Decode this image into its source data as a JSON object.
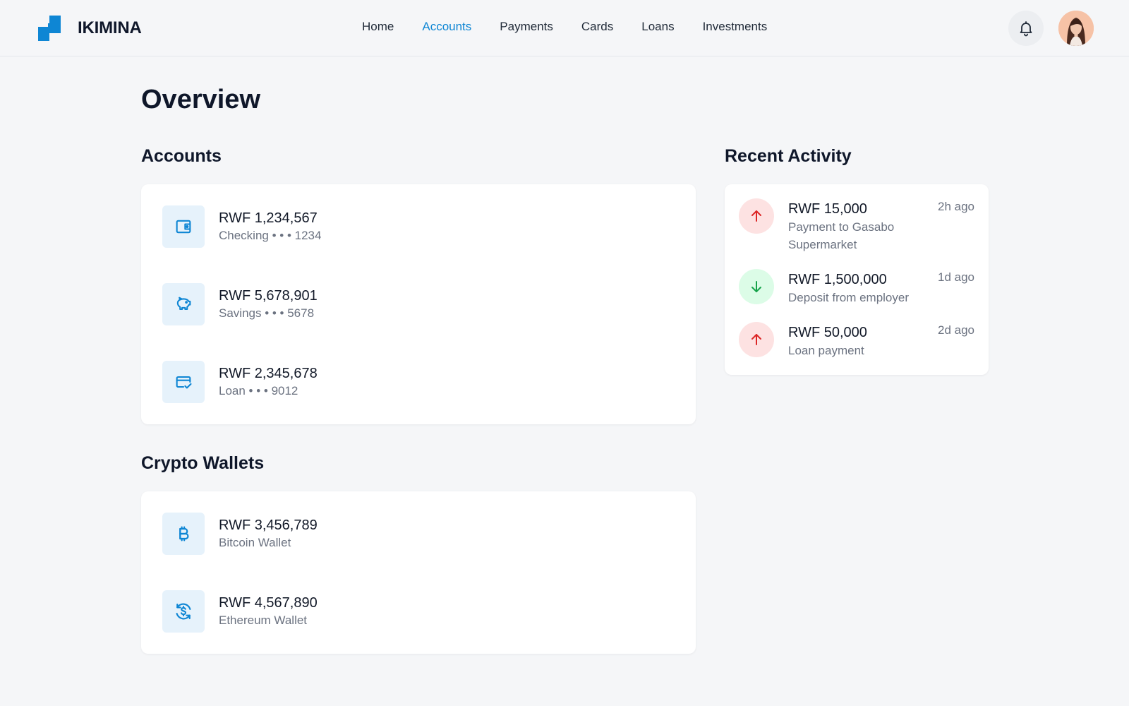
{
  "brand": {
    "name": "IKIMINA"
  },
  "nav": {
    "items": [
      {
        "label": "Home"
      },
      {
        "label": "Accounts"
      },
      {
        "label": "Payments"
      },
      {
        "label": "Cards"
      },
      {
        "label": "Loans"
      },
      {
        "label": "Investments"
      }
    ],
    "active": "Accounts"
  },
  "header": {
    "bell_icon": "bell-icon",
    "avatar": "user-avatar"
  },
  "page": {
    "title": "Overview"
  },
  "accounts": {
    "title": "Accounts",
    "items": [
      {
        "amount": "RWF 1,234,567",
        "label": "Checking • • • 1234",
        "icon": "wallet-icon"
      },
      {
        "amount": "RWF 5,678,901",
        "label": "Savings • • • 5678",
        "icon": "piggy-bank-icon"
      },
      {
        "amount": "RWF 2,345,678",
        "label": "Loan • • • 9012",
        "icon": "credit-card-check-icon"
      }
    ]
  },
  "crypto": {
    "title": "Crypto Wallets",
    "items": [
      {
        "amount": "RWF 3,456,789",
        "label": "Bitcoin Wallet",
        "icon": "bitcoin-icon"
      },
      {
        "amount": "RWF 4,567,890",
        "label": "Ethereum Wallet",
        "icon": "currency-exchange-icon"
      }
    ]
  },
  "activity": {
    "title": "Recent Activity",
    "items": [
      {
        "amount": "RWF 15,000",
        "desc": "Payment to Gasabo Supermarket",
        "time": "2h ago",
        "direction": "out",
        "icon": "arrow-up-icon"
      },
      {
        "amount": "RWF 1,500,000",
        "desc": "Deposit from employer",
        "time": "1d ago",
        "direction": "in",
        "icon": "arrow-down-icon"
      },
      {
        "amount": "RWF 50,000",
        "desc": "Loan payment",
        "time": "2d ago",
        "direction": "out",
        "icon": "arrow-up-icon"
      }
    ]
  },
  "colors": {
    "accent": "#0e86d4",
    "icon_bg": "#e6f2fb",
    "out_bg": "#fde2e2",
    "out_fg": "#dc2626",
    "in_bg": "#dcfce7",
    "in_fg": "#16a34a",
    "background": "#f5f6f8"
  }
}
